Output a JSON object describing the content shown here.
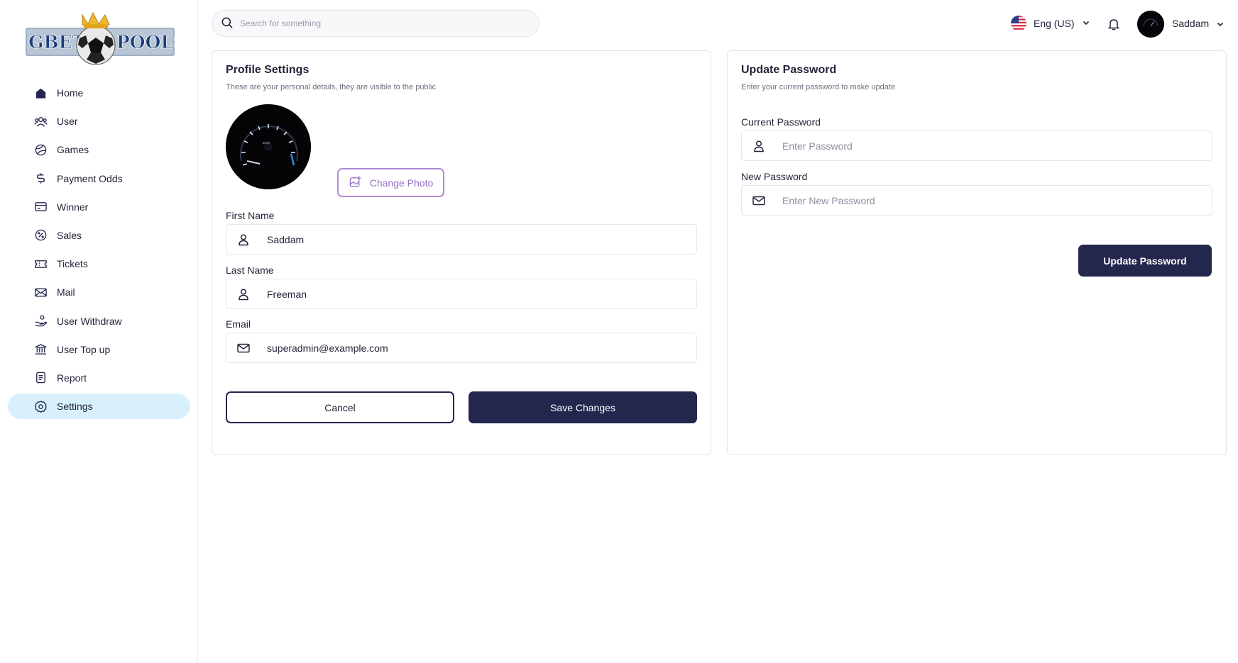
{
  "brand": {
    "logo_left": "GBET",
    "logo_right": "POOLS"
  },
  "sidebar": {
    "items": [
      {
        "label": "Home",
        "icon": "home-icon"
      },
      {
        "label": "User",
        "icon": "users-icon"
      },
      {
        "label": "Games",
        "icon": "ball-icon"
      },
      {
        "label": "Payment Odds",
        "icon": "dollar-icon"
      },
      {
        "label": "Winner",
        "icon": "card-icon"
      },
      {
        "label": "Sales",
        "icon": "discount-icon"
      },
      {
        "label": "Tickets",
        "icon": "ticket-icon"
      },
      {
        "label": "Mail",
        "icon": "mail-icon"
      },
      {
        "label": "User Withdraw",
        "icon": "hand-coin-icon"
      },
      {
        "label": "User Top up",
        "icon": "bank-icon"
      },
      {
        "label": "Report",
        "icon": "report-icon"
      },
      {
        "label": "Settings",
        "icon": "gear-icon",
        "active": true
      }
    ]
  },
  "header": {
    "search_placeholder": "Search for something",
    "language": "Eng (US)",
    "user_name": "Saddam"
  },
  "profile": {
    "title": "Profile Settings",
    "subtitle": "These are your personal details, they are visible to the public",
    "change_photo_label": "Change Photo",
    "first_name_label": "First Name",
    "first_name_value": "Saddam",
    "last_name_label": "Last Name",
    "last_name_value": "Freeman",
    "email_label": "Email",
    "email_value": "superadmin@example.com",
    "cancel_label": "Cancel",
    "save_label": "Save Changes"
  },
  "password": {
    "title": "Update Password",
    "subtitle": "Enter your current password to make update",
    "current_label": "Current Password",
    "current_placeholder": "Enter Password",
    "new_label": "New Password",
    "new_placeholder": "Enter New Password",
    "update_label": "Update Password"
  },
  "colors": {
    "primary": "#23264d",
    "active_nav_bg": "#d7f0fb",
    "change_photo_border": "#b18ad9"
  }
}
